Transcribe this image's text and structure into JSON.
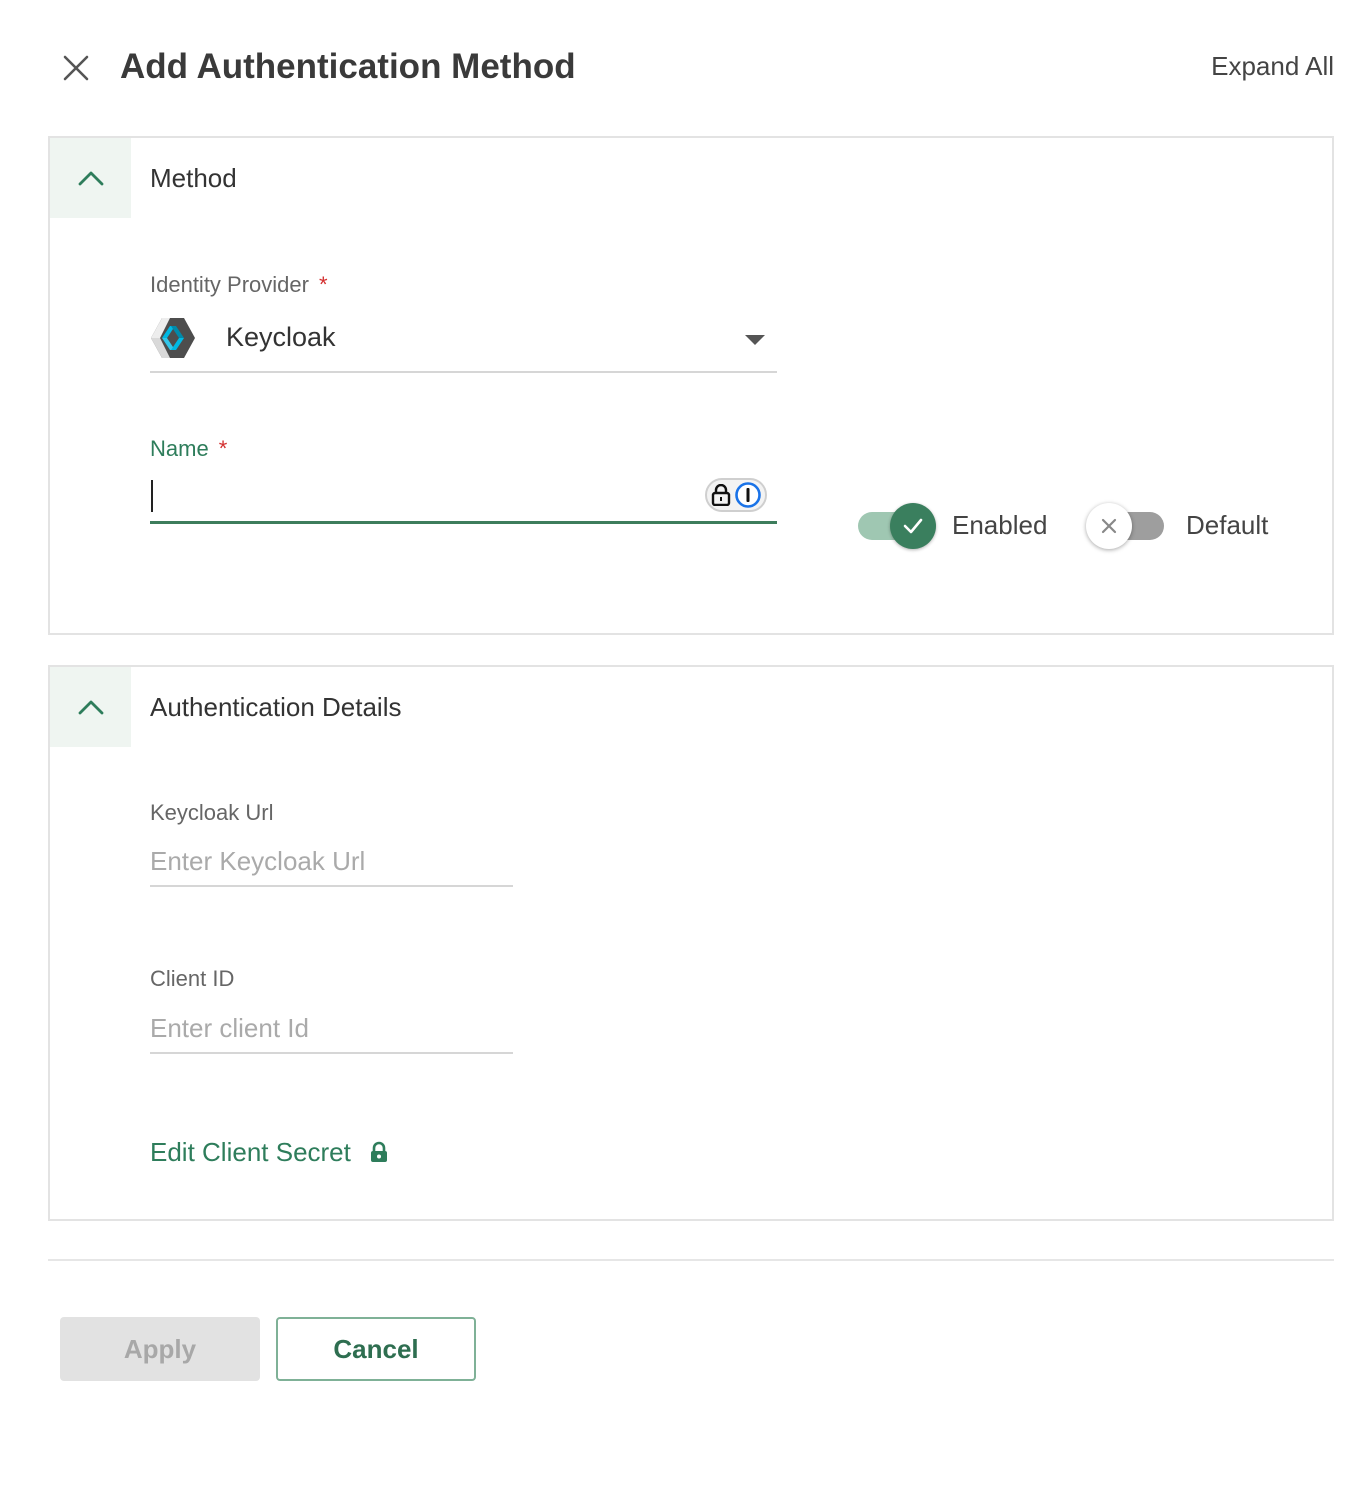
{
  "header": {
    "title": "Add Authentication Method",
    "expand_all_label": "Expand All",
    "close_icon": "close-icon"
  },
  "method_panel": {
    "title": "Method",
    "collapse_icon": "chevron-up-icon",
    "identity_provider": {
      "label": "Identity Provider",
      "required_mark": "*",
      "value": "Keycloak",
      "logo_icon": "keycloak-logo-icon"
    },
    "name": {
      "label": "Name",
      "required_mark": "*",
      "value": "",
      "password_manager_icons": [
        "lock-icon",
        "1password-icon"
      ]
    },
    "enabled_toggle": {
      "label": "Enabled",
      "checked": true,
      "icon": "check-icon"
    },
    "default_toggle": {
      "label": "Default",
      "checked": false,
      "icon": "x-icon"
    }
  },
  "auth_panel": {
    "title": "Authentication Details",
    "collapse_icon": "chevron-up-icon",
    "keycloak_url": {
      "label": "Keycloak Url",
      "placeholder": "Enter Keycloak Url",
      "value": ""
    },
    "client_id": {
      "label": "Client ID",
      "placeholder": "Enter client Id",
      "value": ""
    },
    "edit_client_secret": {
      "label": "Edit Client Secret",
      "icon": "lock-icon"
    }
  },
  "footer": {
    "apply_label": "Apply",
    "apply_disabled": true,
    "cancel_label": "Cancel"
  },
  "colors": {
    "accent": "#2e7d5b",
    "toggle_on_knob": "#3a7f5e",
    "toggle_on_track": "#9fc7b2",
    "toggle_off_track": "#9e9e9e",
    "required": "#d32f2f",
    "panel_header_bg": "#eff5f1"
  }
}
